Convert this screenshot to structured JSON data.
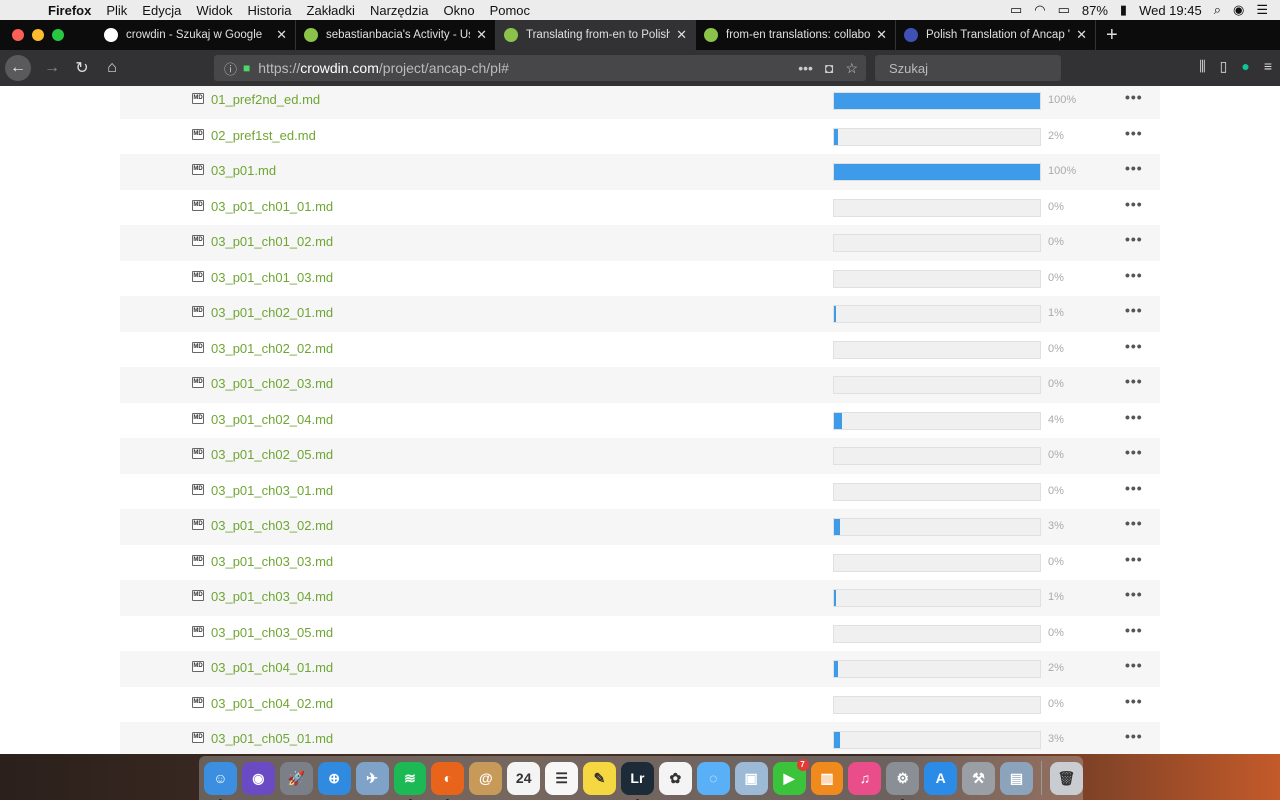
{
  "menubar": {
    "app": "Firefox",
    "items": [
      "Plik",
      "Edycja",
      "Widok",
      "Historia",
      "Zakładki",
      "Narzędzia",
      "Okno",
      "Pomoc"
    ],
    "battery": "87%",
    "clock": "Wed 19:45"
  },
  "tabs": [
    {
      "title": "crowdin - Szukaj w Google",
      "icon_color": "#ffffff",
      "icon": "google-icon",
      "active": false
    },
    {
      "title": "sebastianbacia's Activity - User",
      "icon_color": "#8bc34a",
      "icon": "crowdin-icon",
      "active": false
    },
    {
      "title": "Translating from-en to Polish la",
      "icon_color": "#8bc34a",
      "icon": "crowdin-icon",
      "active": true
    },
    {
      "title": "from-en translations: collabora",
      "icon_color": "#8bc34a",
      "icon": "crowdin-icon",
      "active": false
    },
    {
      "title": "Polish Translation of Ancap \"Fr",
      "icon_color": "#3f51b5",
      "icon": "ancap-icon",
      "active": false
    }
  ],
  "url": {
    "prefix": "https://",
    "host": "crowdin.com",
    "path": "/project/ancap-ch/pl#"
  },
  "search": {
    "placeholder": "Szukaj"
  },
  "colors": {
    "accent": "#3d9be9",
    "link": "#6ea633"
  },
  "files": [
    {
      "name": "01_pref2nd_ed.md",
      "progress": 100,
      "label": "100%"
    },
    {
      "name": "02_pref1st_ed.md",
      "progress": 2,
      "label": "2%"
    },
    {
      "name": "03_p01.md",
      "progress": 100,
      "label": "100%"
    },
    {
      "name": "03_p01_ch01_01.md",
      "progress": 0,
      "label": "0%"
    },
    {
      "name": "03_p01_ch01_02.md",
      "progress": 0,
      "label": "0%"
    },
    {
      "name": "03_p01_ch01_03.md",
      "progress": 0,
      "label": "0%"
    },
    {
      "name": "03_p01_ch02_01.md",
      "progress": 1,
      "label": "1%"
    },
    {
      "name": "03_p01_ch02_02.md",
      "progress": 0,
      "label": "0%"
    },
    {
      "name": "03_p01_ch02_03.md",
      "progress": 0,
      "label": "0%"
    },
    {
      "name": "03_p01_ch02_04.md",
      "progress": 4,
      "label": "4%"
    },
    {
      "name": "03_p01_ch02_05.md",
      "progress": 0,
      "label": "0%"
    },
    {
      "name": "03_p01_ch03_01.md",
      "progress": 0,
      "label": "0%"
    },
    {
      "name": "03_p01_ch03_02.md",
      "progress": 3,
      "label": "3%"
    },
    {
      "name": "03_p01_ch03_03.md",
      "progress": 0,
      "label": "0%"
    },
    {
      "name": "03_p01_ch03_04.md",
      "progress": 1,
      "label": "1%"
    },
    {
      "name": "03_p01_ch03_05.md",
      "progress": 0,
      "label": "0%"
    },
    {
      "name": "03_p01_ch04_01.md",
      "progress": 2,
      "label": "2%"
    },
    {
      "name": "03_p01_ch04_02.md",
      "progress": 0,
      "label": "0%"
    },
    {
      "name": "03_p01_ch05_01.md",
      "progress": 3,
      "label": "3%"
    }
  ],
  "row_menu_label": "•••",
  "file_icon_label": "MD",
  "dock": [
    {
      "name": "finder-icon",
      "color": "#3b8ee0",
      "glyph": "☺",
      "running": true
    },
    {
      "name": "siri-icon",
      "color": "#6a4bc4",
      "glyph": "◉",
      "running": false
    },
    {
      "name": "launchpad-icon",
      "color": "#7a7f88",
      "glyph": "🚀",
      "running": false
    },
    {
      "name": "safari-icon",
      "color": "#2f8ae0",
      "glyph": "⊕",
      "running": false
    },
    {
      "name": "mail-stamp-icon",
      "color": "#7fa3c8",
      "glyph": "✈",
      "running": false
    },
    {
      "name": "spotify-icon",
      "color": "#1db954",
      "glyph": "≋",
      "running": true
    },
    {
      "name": "firefox-icon",
      "color": "#e8641b",
      "glyph": "◐",
      "running": true
    },
    {
      "name": "contacts-icon",
      "color": "#c79a5a",
      "glyph": "@",
      "running": false
    },
    {
      "name": "calendar-icon",
      "color": "#f4f4f4",
      "glyph": "24",
      "running": false
    },
    {
      "name": "reminders-icon",
      "color": "#f7f7f7",
      "glyph": "☰",
      "running": false
    },
    {
      "name": "notes-icon",
      "color": "#f5d742",
      "glyph": "✎",
      "running": false
    },
    {
      "name": "lightroom-icon",
      "color": "#1d2a38",
      "glyph": "Lr",
      "running": true
    },
    {
      "name": "photos-icon",
      "color": "#f4f4f4",
      "glyph": "✿",
      "running": false
    },
    {
      "name": "messages-icon",
      "color": "#5ab0f7",
      "glyph": "◌",
      "running": false
    },
    {
      "name": "preview-icon",
      "color": "#9cb9d6",
      "glyph": "▣",
      "running": false
    },
    {
      "name": "facetime-icon",
      "color": "#3bc43b",
      "glyph": "▶",
      "running": false,
      "badge": "7"
    },
    {
      "name": "ibooks-icon",
      "color": "#f08a1c",
      "glyph": "▥",
      "running": false
    },
    {
      "name": "itunes-icon",
      "color": "#e94e8b",
      "glyph": "♫",
      "running": false
    },
    {
      "name": "system-preferences-icon",
      "color": "#8a8f96",
      "glyph": "⚙",
      "running": true
    },
    {
      "name": "app-store-icon",
      "color": "#2b8ce8",
      "glyph": "A",
      "running": false
    },
    {
      "name": "utility-icon",
      "color": "#9a9ea5",
      "glyph": "⚒",
      "running": false
    },
    {
      "name": "image-capture-icon",
      "color": "#8ba3bb",
      "glyph": "▤",
      "running": false
    },
    {
      "name": "trash-icon",
      "color": "#c9ccd1",
      "glyph": "🗑",
      "running": false
    }
  ]
}
